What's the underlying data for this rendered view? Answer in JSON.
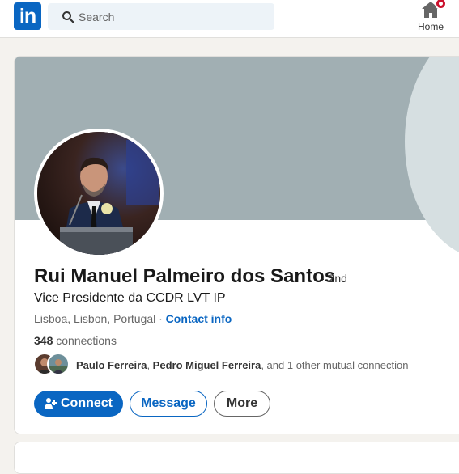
{
  "nav": {
    "logo_text": "in",
    "search_placeholder": "Search",
    "home_label": "Home",
    "brand_color": "#0a66c2"
  },
  "profile": {
    "name": "Rui Manuel Palmeiro dos Santos",
    "degree": "· 2nd",
    "headline": "Vice Presidente da CCDR LVT IP",
    "location": "Lisboa, Lisbon, Portugal",
    "location_sep": " · ",
    "contact_info": "Contact info",
    "connections_count": "348",
    "connections_label": " connections",
    "mutual": {
      "name1": "Paulo Ferreira",
      "sep": ", ",
      "name2": "Pedro Miguel Ferreira",
      "rest": ", and 1 other mutual connection"
    }
  },
  "actions": {
    "connect": "Connect",
    "message": "Message",
    "more": "More"
  }
}
